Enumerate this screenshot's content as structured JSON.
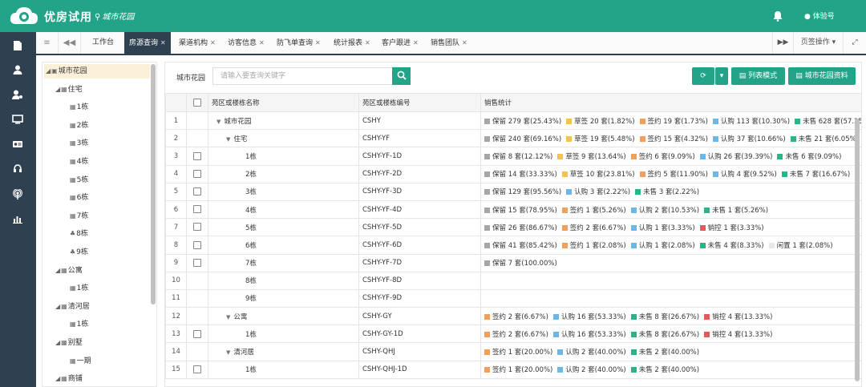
{
  "header": {
    "brand": "优房试用",
    "location": "城市花园",
    "user": "体验号"
  },
  "sidebar_icons": [
    "file-icon",
    "user-icon",
    "user-settings-icon",
    "monitor-icon",
    "id-card-icon",
    "headset-icon",
    "broadcast-icon",
    "bar-chart-icon"
  ],
  "tabbar": {
    "home": "工作台",
    "tabs": [
      "房源查询",
      "渠道机构",
      "访客信息",
      "防飞单查询",
      "统计报表",
      "客户跟进",
      "销售团队"
    ],
    "page_ops": "页签操作"
  },
  "tree": {
    "nodes": [
      {
        "label": "城市花园",
        "depth": 0,
        "type": "building",
        "expand": true,
        "selected": true
      },
      {
        "label": "住宅",
        "depth": 1,
        "type": "folder",
        "expand": true
      },
      {
        "label": "1栋",
        "depth": 2,
        "type": "leaf"
      },
      {
        "label": "2栋",
        "depth": 2,
        "type": "leaf"
      },
      {
        "label": "3栋",
        "depth": 2,
        "type": "leaf"
      },
      {
        "label": "4栋",
        "depth": 2,
        "type": "leaf"
      },
      {
        "label": "5栋",
        "depth": 2,
        "type": "leaf"
      },
      {
        "label": "6栋",
        "depth": 2,
        "type": "leaf"
      },
      {
        "label": "7栋",
        "depth": 2,
        "type": "leaf"
      },
      {
        "label": "8栋",
        "depth": 2,
        "type": "unit"
      },
      {
        "label": "9栋",
        "depth": 2,
        "type": "unit"
      },
      {
        "label": "公寓",
        "depth": 1,
        "type": "grid",
        "expand": true
      },
      {
        "label": "1栋",
        "depth": 2,
        "type": "leaf"
      },
      {
        "label": "清河居",
        "depth": 1,
        "type": "grid",
        "expand": true
      },
      {
        "label": "1栋",
        "depth": 2,
        "type": "leaf"
      },
      {
        "label": "别墅",
        "depth": 1,
        "type": "grid",
        "expand": true
      },
      {
        "label": "一期",
        "depth": 2,
        "type": "leaf"
      },
      {
        "label": "商铺",
        "depth": 1,
        "type": "grid",
        "expand": true
      }
    ]
  },
  "search": {
    "label": "城市花园",
    "placeholder": "请输入要查询关键字"
  },
  "buttons": {
    "list_mode": "列表模式",
    "info": "城市花园资料"
  },
  "colors": {
    "保留": "#a6a6a6",
    "草签": "#f7c24a",
    "签约": "#f0a05a",
    "认购": "#6cb7e5",
    "未售": "#2bb48a",
    "销控": "#e05c5c",
    "闲置": "#e8e8e8"
  },
  "table": {
    "headers": [
      "苑区或楼栋名称",
      "苑区或楼栋编号",
      "销售统计"
    ],
    "rows": [
      {
        "no": "1",
        "name": "城市花园",
        "indent": 0,
        "caret": true,
        "checkbox": false,
        "code": "CSHY",
        "stats": [
          [
            "保留",
            "保留 279 套(25.43%)"
          ],
          [
            "草签",
            "草签 20 套(1.82%)"
          ],
          [
            "签约",
            "签约 19 套(1.73%)"
          ],
          [
            "认购",
            "认购 113 套(10.30%)"
          ],
          [
            "未售",
            "未售 628 套(57.25"
          ]
        ]
      },
      {
        "no": "2",
        "name": "住宅",
        "indent": 1,
        "caret": true,
        "checkbox": false,
        "code": "CSHY-YF",
        "stats": [
          [
            "保留",
            "保留 240 套(69.16%)"
          ],
          [
            "草签",
            "草签 19 套(5.48%)"
          ],
          [
            "签约",
            "签约 15 套(4.32%)"
          ],
          [
            "认购",
            "认购 37 套(10.66%)"
          ],
          [
            "未售",
            "未售 21 套(6.05%)"
          ]
        ]
      },
      {
        "no": "3",
        "name": "1栋",
        "indent": 2,
        "caret": false,
        "checkbox": true,
        "code": "CSHY-YF-1D",
        "stats": [
          [
            "保留",
            "保留 8 套(12.12%)"
          ],
          [
            "草签",
            "草签 9 套(13.64%)"
          ],
          [
            "签约",
            "签约 6 套(9.09%)"
          ],
          [
            "认购",
            "认购 26 套(39.39%)"
          ],
          [
            "未售",
            "未售 6 套(9.09%)"
          ]
        ]
      },
      {
        "no": "4",
        "name": "2栋",
        "indent": 2,
        "caret": false,
        "checkbox": true,
        "code": "CSHY-YF-2D",
        "stats": [
          [
            "保留",
            "保留 14 套(33.33%)"
          ],
          [
            "草签",
            "草签 10 套(23.81%)"
          ],
          [
            "签约",
            "签约 5 套(11.90%)"
          ],
          [
            "认购",
            "认购 4 套(9.52%)"
          ],
          [
            "未售",
            "未售 7 套(16.67%)"
          ]
        ]
      },
      {
        "no": "5",
        "name": "3栋",
        "indent": 2,
        "caret": false,
        "checkbox": true,
        "code": "CSHY-YF-3D",
        "stats": [
          [
            "保留",
            "保留 129 套(95.56%)"
          ],
          [
            "认购",
            "认购 3 套(2.22%)"
          ],
          [
            "未售",
            "未售 3 套(2.22%)"
          ]
        ]
      },
      {
        "no": "6",
        "name": "4栋",
        "indent": 2,
        "caret": false,
        "checkbox": true,
        "code": "CSHY-YF-4D",
        "stats": [
          [
            "保留",
            "保留 15 套(78.95%)"
          ],
          [
            "签约",
            "签约 1 套(5.26%)"
          ],
          [
            "认购",
            "认购 2 套(10.53%)"
          ],
          [
            "未售",
            "未售 1 套(5.26%)"
          ]
        ]
      },
      {
        "no": "7",
        "name": "5栋",
        "indent": 2,
        "caret": false,
        "checkbox": true,
        "code": "CSHY-YF-5D",
        "stats": [
          [
            "保留",
            "保留 26 套(86.67%)"
          ],
          [
            "签约",
            "签约 2 套(6.67%)"
          ],
          [
            "认购",
            "认购 1 套(3.33%)"
          ],
          [
            "销控",
            "销控 1 套(3.33%)"
          ]
        ]
      },
      {
        "no": "8",
        "name": "6栋",
        "indent": 2,
        "caret": false,
        "checkbox": true,
        "code": "CSHY-YF-6D",
        "stats": [
          [
            "保留",
            "保留 41 套(85.42%)"
          ],
          [
            "签约",
            "签约 1 套(2.08%)"
          ],
          [
            "认购",
            "认购 1 套(2.08%)"
          ],
          [
            "未售",
            "未售 4 套(8.33%)"
          ],
          [
            "闲置",
            "闲置 1 套(2.08%)"
          ]
        ]
      },
      {
        "no": "9",
        "name": "7栋",
        "indent": 2,
        "caret": false,
        "checkbox": true,
        "code": "CSHY-YF-7D",
        "stats": [
          [
            "保留",
            "保留 7 套(100.00%)"
          ]
        ]
      },
      {
        "no": "10",
        "name": "8栋",
        "indent": 2,
        "caret": false,
        "checkbox": false,
        "code": "CSHY-YF-8D",
        "stats": []
      },
      {
        "no": "11",
        "name": "9栋",
        "indent": 2,
        "caret": false,
        "checkbox": false,
        "code": "CSHY-YF-9D",
        "stats": []
      },
      {
        "no": "12",
        "name": "公寓",
        "indent": 1,
        "caret": true,
        "checkbox": false,
        "code": "CSHY-GY",
        "stats": [
          [
            "签约",
            "签约 2 套(6.67%)"
          ],
          [
            "认购",
            "认购 16 套(53.33%)"
          ],
          [
            "未售",
            "未售 8 套(26.67%)"
          ],
          [
            "销控",
            "销控 4 套(13.33%)"
          ]
        ]
      },
      {
        "no": "13",
        "name": "1栋",
        "indent": 2,
        "caret": false,
        "checkbox": true,
        "code": "CSHY-GY-1D",
        "stats": [
          [
            "签约",
            "签约 2 套(6.67%)"
          ],
          [
            "认购",
            "认购 16 套(53.33%)"
          ],
          [
            "未售",
            "未售 8 套(26.67%)"
          ],
          [
            "销控",
            "销控 4 套(13.33%)"
          ]
        ]
      },
      {
        "no": "14",
        "name": "清河居",
        "indent": 1,
        "caret": true,
        "checkbox": false,
        "code": "CSHY-QHJ",
        "stats": [
          [
            "签约",
            "签约 1 套(20.00%)"
          ],
          [
            "认购",
            "认购 2 套(40.00%)"
          ],
          [
            "未售",
            "未售 2 套(40.00%)"
          ]
        ]
      },
      {
        "no": "15",
        "name": "1栋",
        "indent": 2,
        "caret": false,
        "checkbox": true,
        "code": "CSHY-QHJ-1D",
        "stats": [
          [
            "签约",
            "签约 1 套(20.00%)"
          ],
          [
            "认购",
            "认购 2 套(40.00%)"
          ],
          [
            "未售",
            "未售 2 套(40.00%)"
          ]
        ]
      }
    ]
  }
}
